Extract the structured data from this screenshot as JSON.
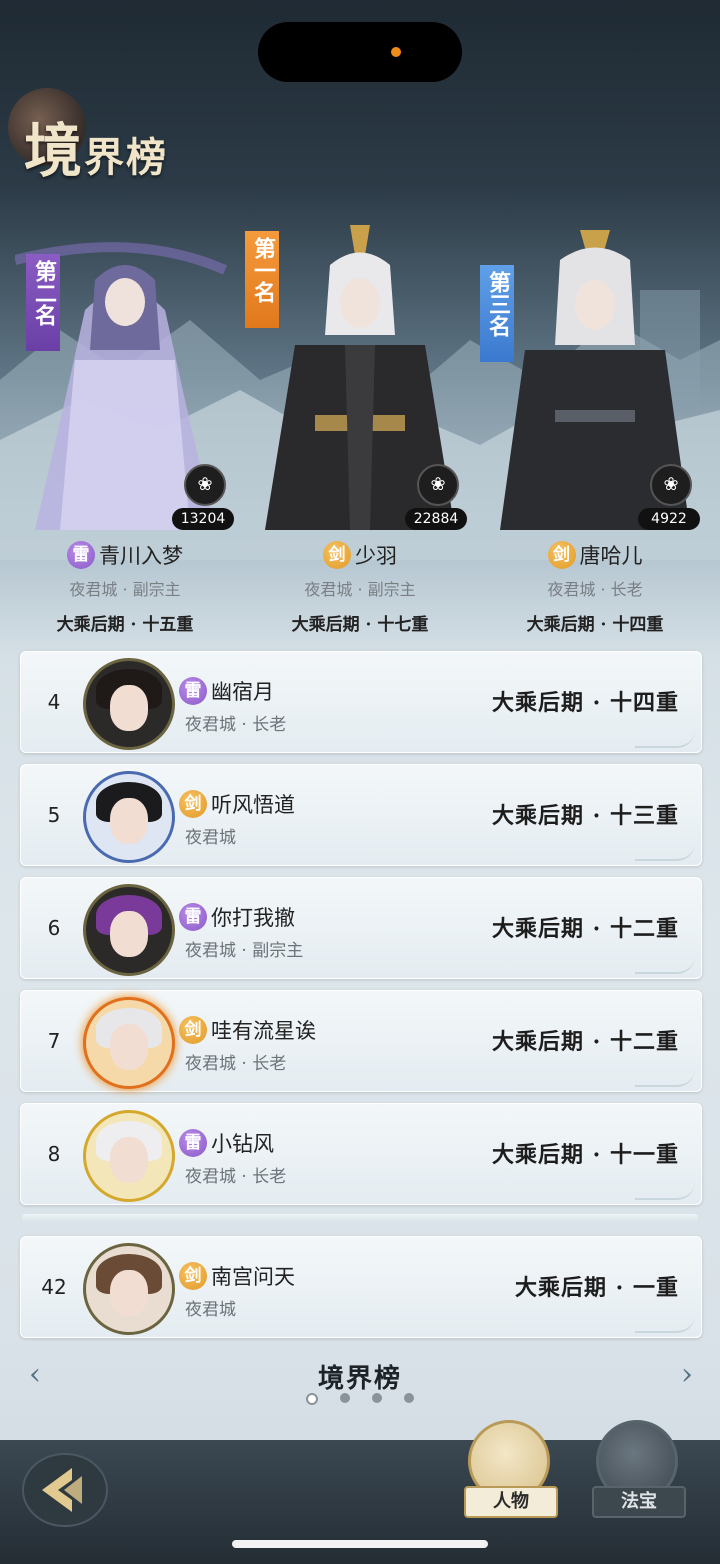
{
  "header": {
    "title_big": "境",
    "title_rest": "界榜"
  },
  "top3": [
    {
      "ribbon": "第二名",
      "power": "13204",
      "element": "雷",
      "name": "青川入梦",
      "sect": "夜君城 · 副宗主",
      "realm": "大乘后期 · 十五重"
    },
    {
      "ribbon": "第一名",
      "power": "22884",
      "element": "剑",
      "name": "少羽",
      "sect": "夜君城 · 副宗主",
      "realm": "大乘后期 · 十七重"
    },
    {
      "ribbon": "第三名",
      "power": "4922",
      "element": "剑",
      "name": "唐哈儿",
      "sect": "夜君城 · 长老",
      "realm": "大乘后期 · 十四重"
    }
  ],
  "rows": [
    {
      "rank": "4",
      "element": "雷",
      "name": "幽宿月",
      "sect": "夜君城 · 长老",
      "realm": "大乘后期 · 十四重"
    },
    {
      "rank": "5",
      "element": "剑",
      "name": "听风悟道",
      "sect": "夜君城",
      "realm": "大乘后期 · 十三重"
    },
    {
      "rank": "6",
      "element": "雷",
      "name": "你打我撤",
      "sect": "夜君城 · 副宗主",
      "realm": "大乘后期 · 十二重"
    },
    {
      "rank": "7",
      "element": "剑",
      "name": "哇有流星诶",
      "sect": "夜君城 · 长老",
      "realm": "大乘后期 · 十二重"
    },
    {
      "rank": "8",
      "element": "雷",
      "name": "小钻风",
      "sect": "夜君城 · 长老",
      "realm": "大乘后期 · 十一重"
    }
  ],
  "self_row": {
    "rank": "42",
    "element": "剑",
    "name": "南宫问天",
    "sect": "夜君城",
    "realm": "大乘后期 · 一重"
  },
  "pager": {
    "title": "境界榜",
    "page_index": 1,
    "page_count": 4
  },
  "tabs": {
    "characters": "人物",
    "treasures": "法宝"
  },
  "colors": {
    "lei": "#8b5ac9",
    "jian": "#e19a25",
    "gold": "#f1e5c9"
  }
}
